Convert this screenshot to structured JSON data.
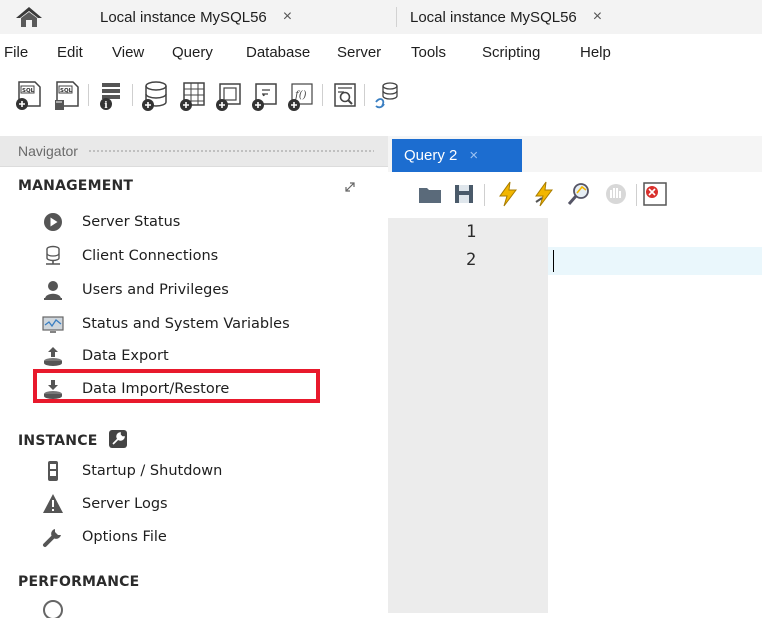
{
  "window_tabs": [
    {
      "label": "Local instance MySQL56",
      "close": "×"
    },
    {
      "label": "Local instance MySQL56",
      "close": "×"
    }
  ],
  "menu": [
    "File",
    "Edit",
    "View",
    "Query",
    "Database",
    "Server",
    "Tools",
    "Scripting",
    "Help"
  ],
  "navigator": {
    "title": "Navigator",
    "sections": [
      {
        "title": "MANAGEMENT",
        "items": [
          {
            "label": "Server Status",
            "icon": "server-status-icon"
          },
          {
            "label": "Client Connections",
            "icon": "client-connections-icon"
          },
          {
            "label": "Users and Privileges",
            "icon": "users-icon"
          },
          {
            "label": "Status and System Variables",
            "icon": "monitor-icon"
          },
          {
            "label": "Data Export",
            "icon": "data-export-icon"
          },
          {
            "label": "Data Import/Restore",
            "icon": "data-import-icon"
          }
        ]
      },
      {
        "title": "INSTANCE",
        "items": [
          {
            "label": "Startup / Shutdown",
            "icon": "startup-icon"
          },
          {
            "label": "Server Logs",
            "icon": "warning-icon"
          },
          {
            "label": "Options File",
            "icon": "wrench-icon"
          }
        ]
      },
      {
        "title": "PERFORMANCE",
        "items": []
      }
    ]
  },
  "editor": {
    "tab": {
      "label": "Query 2",
      "close": "×"
    },
    "line_numbers": [
      "1",
      "2"
    ]
  },
  "colors": {
    "accent": "#1c6dd0",
    "highlight": "#e8192c",
    "gutter": "#ececec",
    "current_line": "#eaf7fc"
  }
}
